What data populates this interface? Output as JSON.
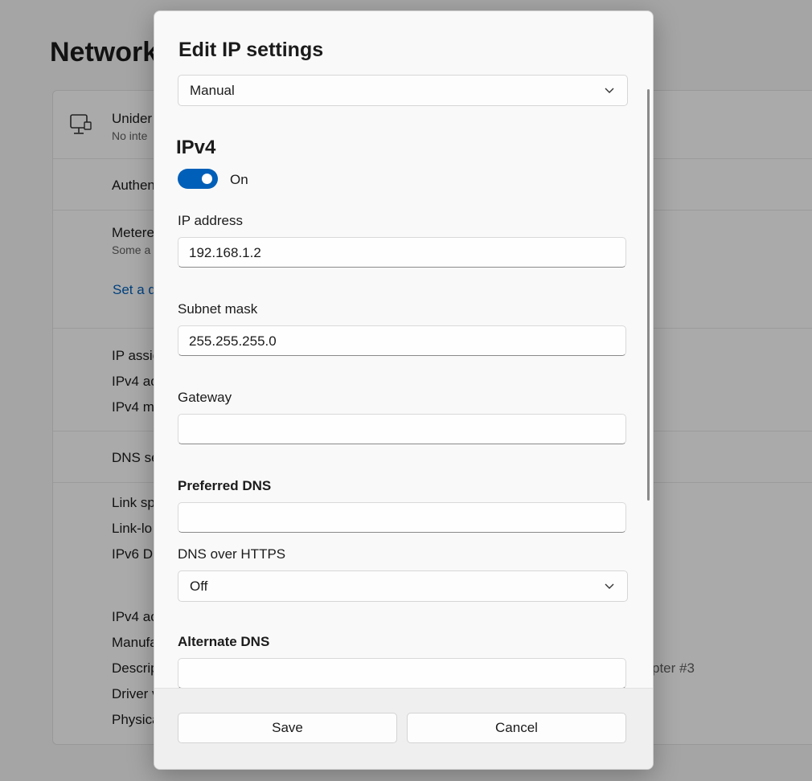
{
  "background": {
    "page_title": "Network",
    "adapter_name": "Unider",
    "adapter_status": "No inte",
    "auth_label": "Authen",
    "metered_label": "Metere",
    "metered_sub": "Some a",
    "data_limit_link": "Set a d",
    "ip_assignment": "IP assig",
    "ipv4_address": "IPv4 ac",
    "ipv4_mask": "IPv4 m",
    "dns_server": "DNS se",
    "link_speed": "Link sp",
    "link_local": "Link-lo",
    "ipv6_dns": "IPv6 DI",
    "ipv4_address2": "IPv4 ac",
    "manufacturer": "Manufa",
    "description": "Descrip",
    "description_value": "pter #3",
    "driver": "Driver v",
    "physical": "Physica"
  },
  "dialog": {
    "title": "Edit IP settings",
    "mode_select": "Manual",
    "section_title": "IPv4",
    "toggle_label": "On",
    "ip_address_label": "IP address",
    "ip_address_value": "192.168.1.2",
    "subnet_label": "Subnet mask",
    "subnet_value": "255.255.255.0",
    "gateway_label": "Gateway",
    "gateway_value": "",
    "preferred_dns_label": "Preferred DNS",
    "preferred_dns_value": "",
    "doh_label": "DNS over HTTPS",
    "doh_value": "Off",
    "alternate_dns_label": "Alternate DNS",
    "save_label": "Save",
    "cancel_label": "Cancel"
  },
  "colors": {
    "accent": "#005fb8",
    "toggle_on": "#005fb8"
  }
}
